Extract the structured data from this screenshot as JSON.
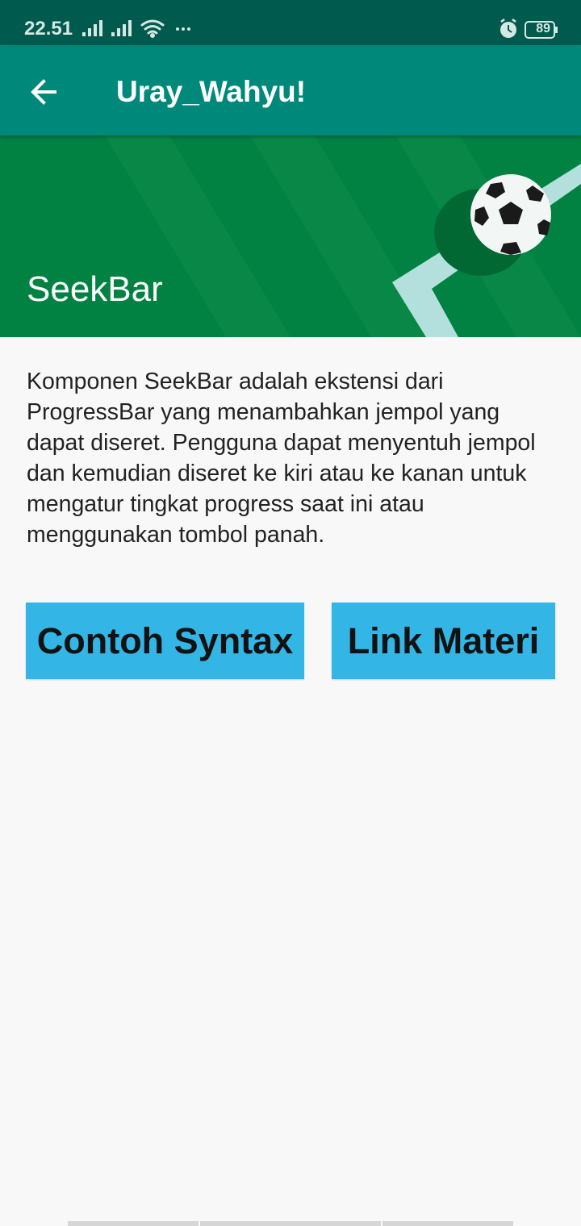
{
  "status_bar": {
    "time": "22.51",
    "battery": "89",
    "icons": [
      "signal-icon",
      "signal-icon",
      "wifi-icon",
      "more-icon",
      "alarm-icon",
      "battery-icon"
    ]
  },
  "toolbar": {
    "title": "Uray_Wahyu!",
    "back_icon": "arrow-left-icon"
  },
  "banner": {
    "title": "SeekBar",
    "colors": {
      "field": "#018142",
      "line": "#b2dfdb"
    }
  },
  "content": {
    "description": "Komponen SeekBar adalah ekstensi dari ProgressBar yang menambahkan jempol yang dapat diseret. Pengguna dapat menyentuh jempol dan kemudian diseret ke kiri atau ke kanan untuk mengatur tingkat progress saat ini atau menggunakan tombol panah."
  },
  "buttons": {
    "syntax_label": "Contoh Syntax",
    "link_label": "Link Materi",
    "color": "#33b5e5"
  },
  "colors": {
    "status_bar": "#005a4e",
    "toolbar": "#00897b",
    "background": "#f8f8f8"
  }
}
